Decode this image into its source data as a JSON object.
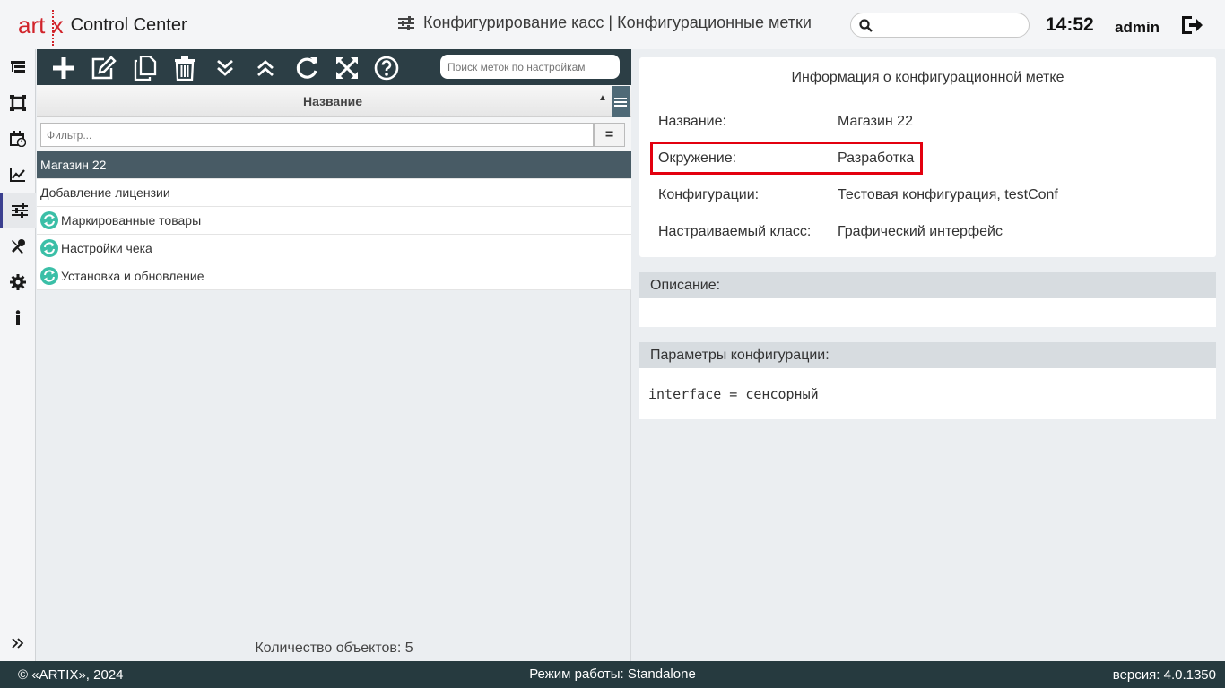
{
  "header": {
    "logo_artix": "art",
    "logo_x": "x",
    "logo_cc": "Control Center",
    "title": "Конфигурирование касс | Конфигурационные метки",
    "search_placeholder": "",
    "time": "14:52",
    "user": "admin"
  },
  "leftnav": {
    "items": [
      "tree-icon",
      "frame-icon",
      "calendar-icon",
      "chart-icon",
      "sliders-icon",
      "tools-icon",
      "gear-icon",
      "info-icon"
    ],
    "active": "sliders-icon"
  },
  "toolbar": {
    "search_placeholder": "Поиск меток по настройкам"
  },
  "grid": {
    "column": "Название",
    "filter_placeholder": "Фильтр...",
    "filter_op": "=",
    "rows": [
      {
        "label": "Магазин 22",
        "icon": false,
        "selected": true
      },
      {
        "label": "Добавление лицензии",
        "icon": false,
        "selected": false
      },
      {
        "label": "Маркированные товары",
        "icon": true,
        "selected": false
      },
      {
        "label": "Настройки чека",
        "icon": true,
        "selected": false
      },
      {
        "label": "Установка и обновление",
        "icon": true,
        "selected": false
      }
    ],
    "count": "Количество объектов: 5"
  },
  "info": {
    "title": "Информация о конфигурационной метке",
    "fields": [
      {
        "label": "Название:",
        "value": "Магазин 22"
      },
      {
        "label": "Окружение:",
        "value": "Разработка"
      },
      {
        "label": "Конфигурации:",
        "value": "Тестовая конфигурация, testConf"
      },
      {
        "label": "Настраиваемый класс:",
        "value": "Графический интерфейс"
      }
    ]
  },
  "description": {
    "title": "Описание:",
    "text": ""
  },
  "params": {
    "title": "Параметры конфигурации:",
    "text": "interface = сенсорный"
  },
  "footer": {
    "copyright": "© «ARTIX», 2024",
    "mode": "Режим работы: Standalone",
    "version": "версия: 4.0.1350"
  },
  "colors": {
    "brand": "#d1232a",
    "toolbar": "#2c3e45",
    "selected_row": "#485b65",
    "highlight": "#e3000f",
    "sync_icon": "#3bbfa7"
  }
}
